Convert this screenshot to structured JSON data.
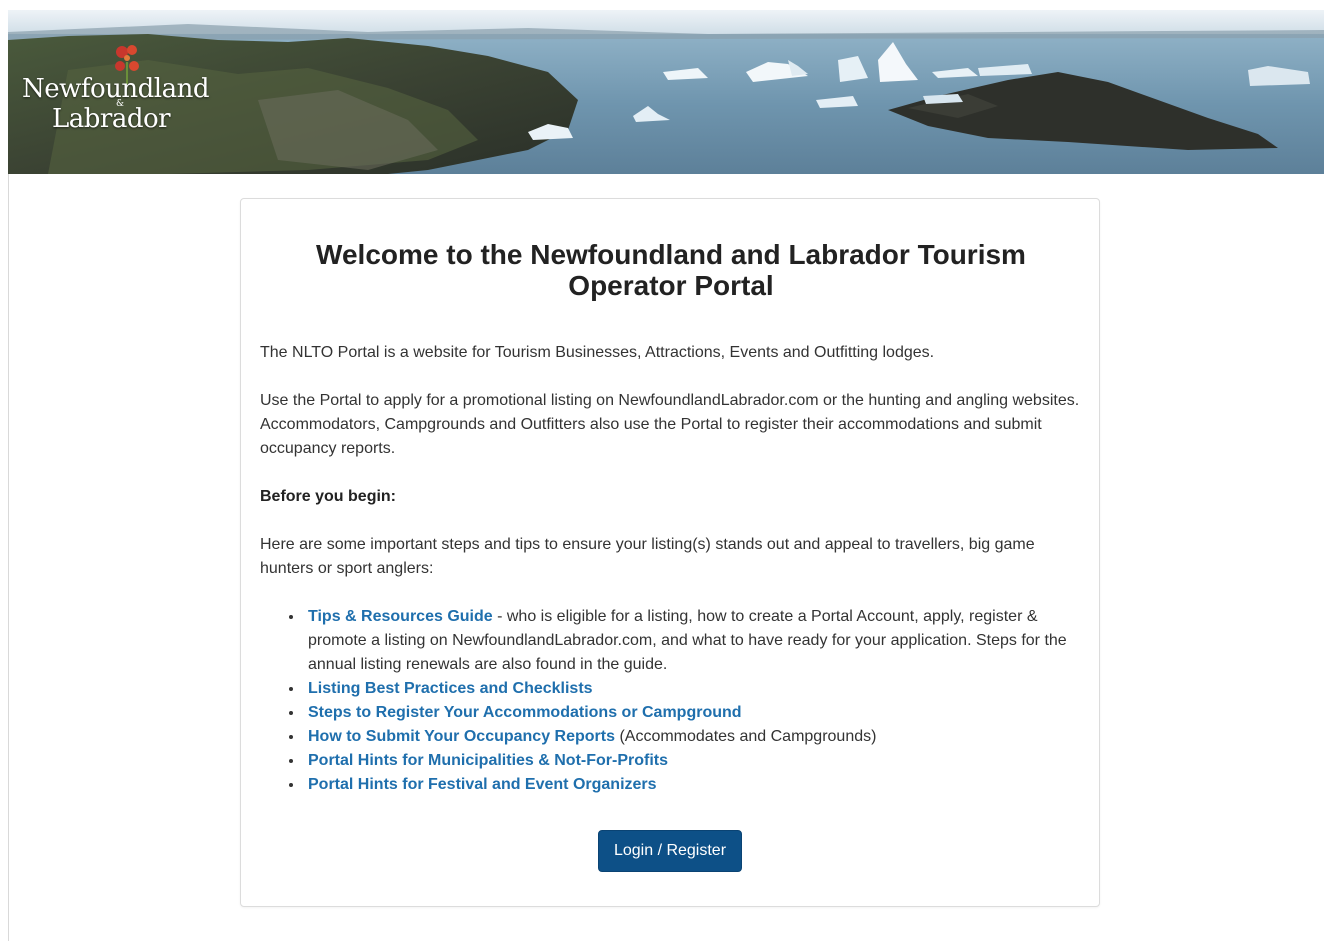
{
  "banner": {
    "logo": {
      "word1": "Newfoundland",
      "amp": "&",
      "word2": "Labrador"
    }
  },
  "card": {
    "title": "Welcome to the Newfoundland and Labrador Tourism Operator Portal",
    "intro": "The NLTO Portal is a website for Tourism Businesses, Attractions, Events and Outfitting lodges.",
    "usage": "Use the Portal to apply for a promotional listing on NewfoundlandLabrador.com or the hunting and angling websites. Accommodators, Campgrounds and Outfitters also use the Portal to register their accommodations and submit occupancy reports.",
    "before_heading": "Before you begin:",
    "tips_intro": "Here are some important steps and tips to ensure your listing(s) stands out and appeal to travellers, big game hunters or sport anglers:",
    "links": [
      {
        "label": "Tips & Resources Guide",
        "suffix": " - who is eligible for a listing, how to create a Portal Account, apply, register & promote a listing on NewfoundlandLabrador.com, and what to have ready for your application. Steps for the annual listing renewals are also found in the guide."
      },
      {
        "label": "Listing Best Practices and Checklists",
        "suffix": ""
      },
      {
        "label": "Steps to Register Your Accommodations or Campground",
        "suffix": ""
      },
      {
        "label": "How to Submit Your Occupancy Reports",
        "suffix": " (Accommodates and Campgrounds)"
      },
      {
        "label": "Portal Hints for Municipalities & Not-For-Profits",
        "suffix": ""
      },
      {
        "label": "Portal Hints for Festival and Event Organizers",
        "suffix": ""
      }
    ],
    "login_button": "Login / Register"
  },
  "colors": {
    "link": "#1f6fad",
    "button_bg": "#0d5087",
    "text": "#333333"
  }
}
